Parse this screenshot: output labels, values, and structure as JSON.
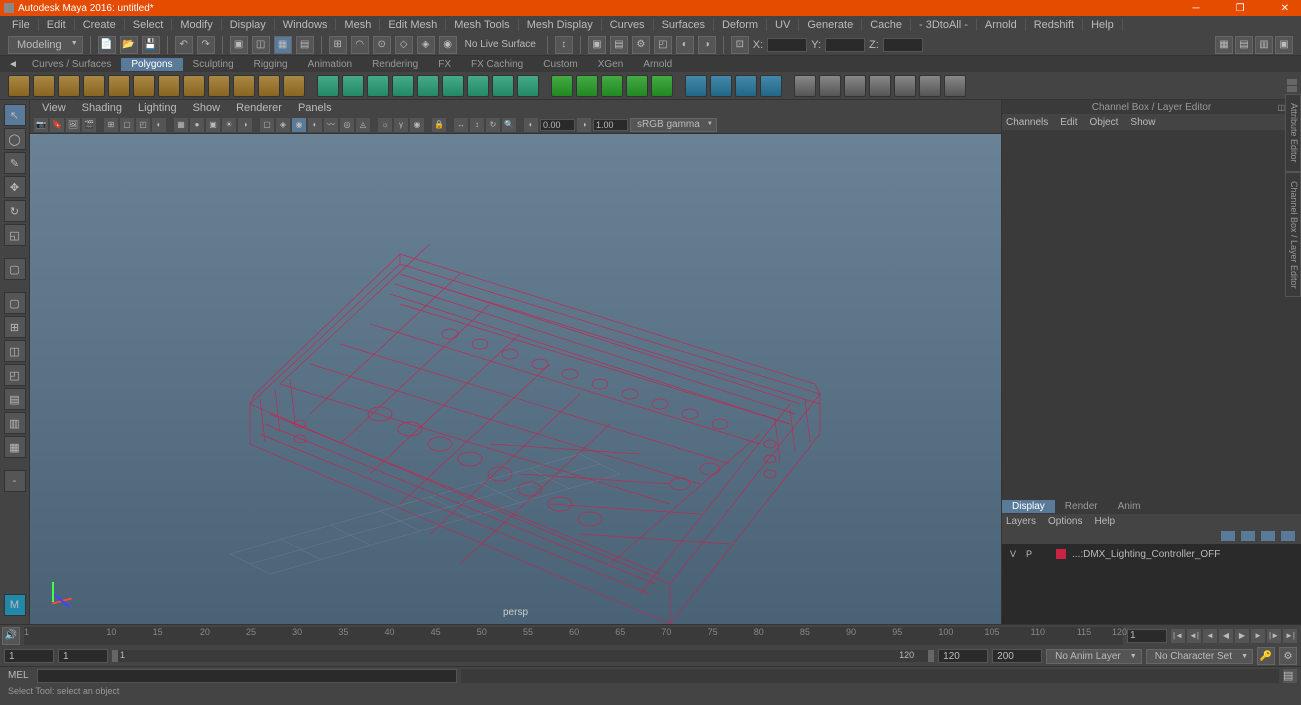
{
  "titlebar": {
    "title": "Autodesk Maya 2016: untitled*"
  },
  "menubar": [
    "File",
    "Edit",
    "Create",
    "Select",
    "Modify",
    "Display",
    "Windows",
    "Mesh",
    "Edit Mesh",
    "Mesh Tools",
    "Mesh Display",
    "Curves",
    "Surfaces",
    "Deform",
    "UV",
    "Generate",
    "Cache",
    "- 3DtoAll -",
    "Arnold",
    "Redshift",
    "Help"
  ],
  "statusline": {
    "workspace": "Modeling",
    "nolive": "No Live Surface",
    "x_label": "X:",
    "y_label": "Y:",
    "z_label": "Z:"
  },
  "shelf_tabs": [
    "Curves / Surfaces",
    "Polygons",
    "Sculpting",
    "Rigging",
    "Animation",
    "Rendering",
    "FX",
    "FX Caching",
    "Custom",
    "XGen",
    "Arnold"
  ],
  "shelf_active": "Polygons",
  "panel_menu": [
    "View",
    "Shading",
    "Lighting",
    "Show",
    "Renderer",
    "Panels"
  ],
  "panel_toolbar": {
    "v1": "0.00",
    "v2": "1.00",
    "colorspace": "sRGB gamma"
  },
  "viewport": {
    "camera": "persp"
  },
  "right_panel": {
    "header": "Channel Box / Layer Editor",
    "menu": [
      "Channels",
      "Edit",
      "Object",
      "Show"
    ]
  },
  "layer_section": {
    "tabs": [
      "Display",
      "Render",
      "Anim"
    ],
    "active": "Display",
    "menu": [
      "Layers",
      "Options",
      "Help"
    ],
    "layer": {
      "v": "V",
      "p": "P",
      "name": "...:DMX_Lighting_Controller_OFF"
    }
  },
  "attr_tabs": [
    "Attribute Editor",
    "Channel Box / Layer Editor"
  ],
  "timeline": {
    "ticks": [
      "1",
      "10",
      "15",
      "20",
      "25",
      "30",
      "35",
      "40",
      "45",
      "50",
      "55",
      "60",
      "65",
      "70",
      "75",
      "80",
      "85",
      "90",
      "95",
      "100",
      "105",
      "110",
      "115",
      "120"
    ],
    "current": "1"
  },
  "range": {
    "start": "1",
    "range_start": "1",
    "range_end_val": "120",
    "end": "120",
    "total": "200",
    "noanim": "No Anim Layer",
    "nochar": "No Character Set"
  },
  "cmdline": {
    "label": "MEL"
  },
  "helpline": {
    "text": "Select Tool: select an object"
  }
}
